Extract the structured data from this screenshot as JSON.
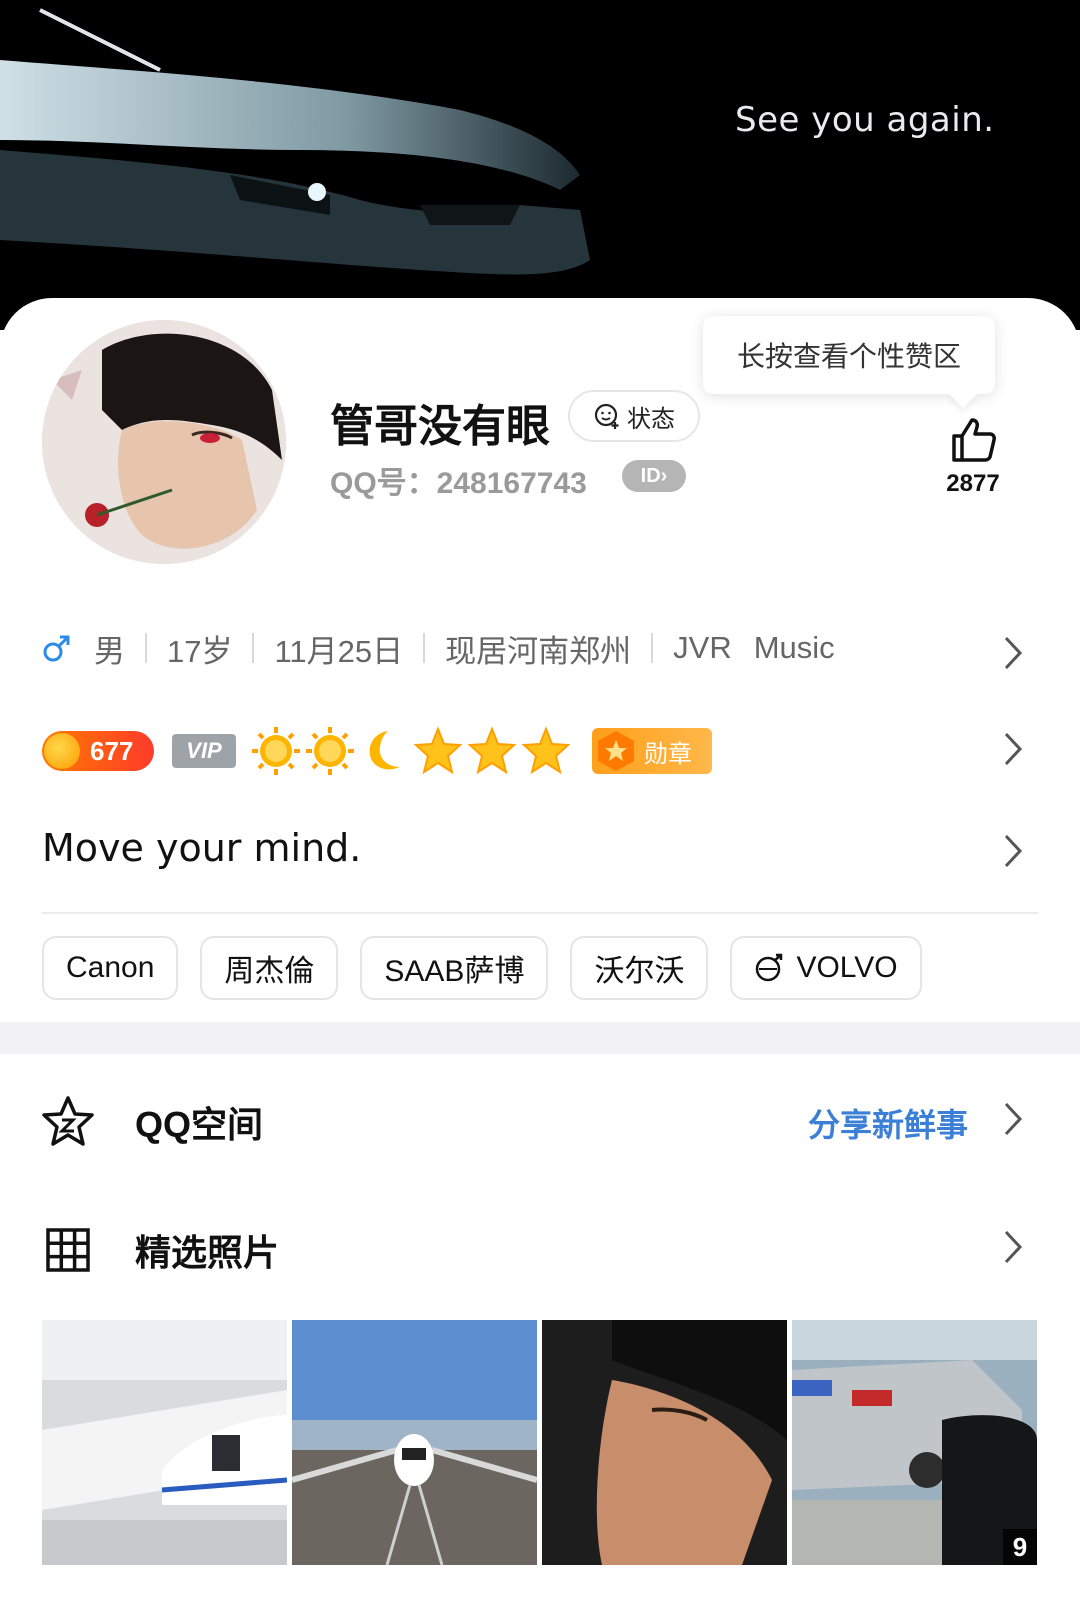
{
  "cover": {
    "tagline": "See you again."
  },
  "profile": {
    "name": "管哥没有眼",
    "status_label": "状态",
    "qq_number": "QQ号：248167743",
    "id_badge": "ID",
    "tooltip": "长按查看个性赞区",
    "like_count": "2877"
  },
  "info": {
    "gender_icon": "male-icon",
    "gender": "男",
    "age": "17岁",
    "birthday": "11月25日",
    "location": "现居河南郑州",
    "extra_1": "JVR",
    "extra_2": "Music"
  },
  "badges": {
    "level": "677",
    "vip": "VIP",
    "medal_label": "勋章",
    "icons": [
      "sun-icon",
      "sun-icon",
      "moon-icon",
      "star-icon",
      "star-icon",
      "star-icon"
    ]
  },
  "signature": "Move your mind.",
  "tags": [
    "Canon",
    "周杰倫",
    "SAAB萨博",
    "沃尔沃",
    "VOLVO"
  ],
  "sections": {
    "qzone": {
      "label": "QQ空间",
      "action": "分享新鲜事"
    },
    "photos": {
      "label": "精选照片",
      "more_count": "9"
    }
  },
  "colors": {
    "accent_blue": "#3c7fd6",
    "male_blue": "#2b8ce8",
    "level_orange": "#ff5a1f",
    "medal_orange": "#ffa21f"
  }
}
